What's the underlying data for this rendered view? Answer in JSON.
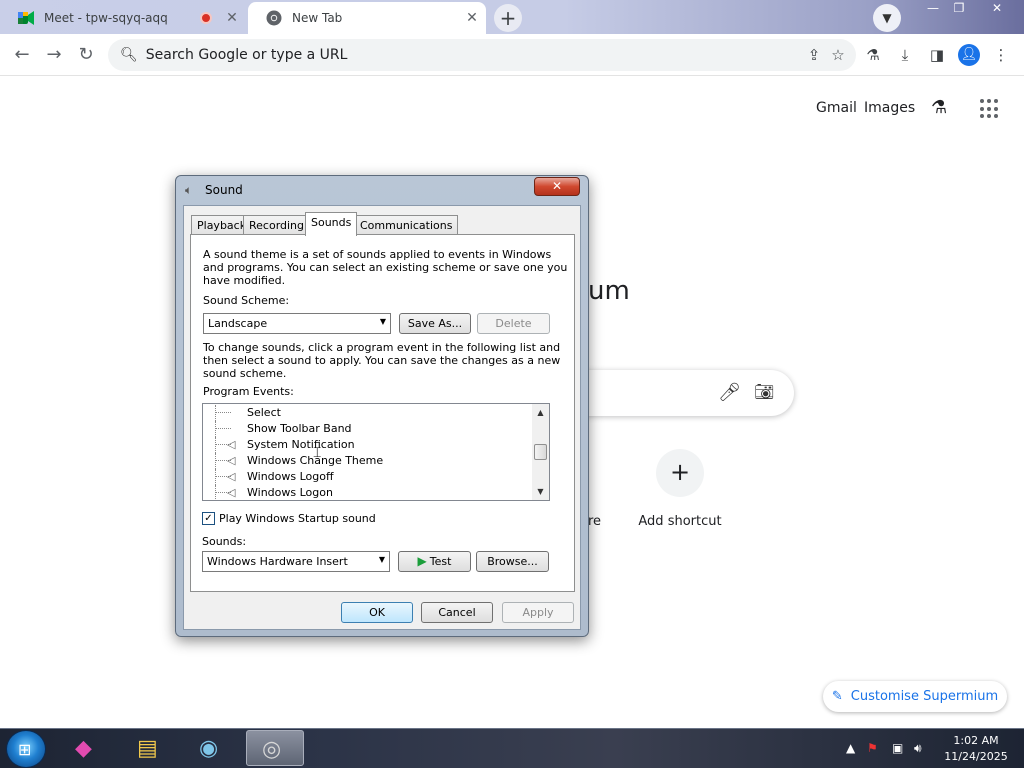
{
  "browser": {
    "tabs": [
      {
        "title": "Meet - tpw-sqyq-aqq",
        "active": false,
        "recording": true
      },
      {
        "title": "New Tab",
        "active": true
      }
    ],
    "omnibox_placeholder": "Search Google or type a URL",
    "tab_close": "✕",
    "new_tab": "+",
    "window_controls": {
      "minimize": "—",
      "maximize": "❐",
      "close": "✕"
    }
  },
  "ntp": {
    "links": {
      "gmail": "Gmail",
      "images": "Images"
    },
    "title_fragment": "um",
    "shortcut": {
      "plus": "+",
      "label": "Add shortcut"
    },
    "partial_label": "re",
    "customise": "Customise Supermium"
  },
  "dialog": {
    "title": "Sound",
    "close": "✕",
    "tabs": [
      "Playback",
      "Recording",
      "Sounds",
      "Communications"
    ],
    "active_tab": "Sounds",
    "intro_lines": [
      "A sound theme is a set of sounds applied to events in Windows",
      "and programs.  You can select an existing scheme or save one you",
      "have modified."
    ],
    "scheme_label": "Sound Scheme:",
    "scheme_value": "Landscape",
    "save_as": "Save As...",
    "delete": "Delete",
    "change_lines": [
      "To change sounds, click a program event in the following list and",
      "then select a sound to apply.  You can save the changes as a new",
      "sound scheme."
    ],
    "events_label": "Program Events:",
    "events": [
      {
        "label": "Select",
        "sound": false
      },
      {
        "label": "Show Toolbar Band",
        "sound": false
      },
      {
        "label": "System Notification",
        "sound": true
      },
      {
        "label": "Windows Change Theme",
        "sound": true
      },
      {
        "label": "Windows Logoff",
        "sound": true
      },
      {
        "label": "Windows Logon",
        "sound": true
      }
    ],
    "startup_checked": true,
    "startup_label": "Play Windows Startup sound",
    "sounds_label": "Sounds:",
    "sound_value": "Windows Hardware Insert",
    "test": "Test",
    "browse": "Browse...",
    "ok": "OK",
    "cancel": "Cancel",
    "apply": "Apply"
  },
  "taskbar": {
    "time": "1:02 AM",
    "date": "11/24/2025"
  },
  "colors": {
    "accent_blue": "#1a73e8",
    "close_red": "#d0482f",
    "recording_red": "#d93025",
    "play_green": "#1b9e3b"
  }
}
